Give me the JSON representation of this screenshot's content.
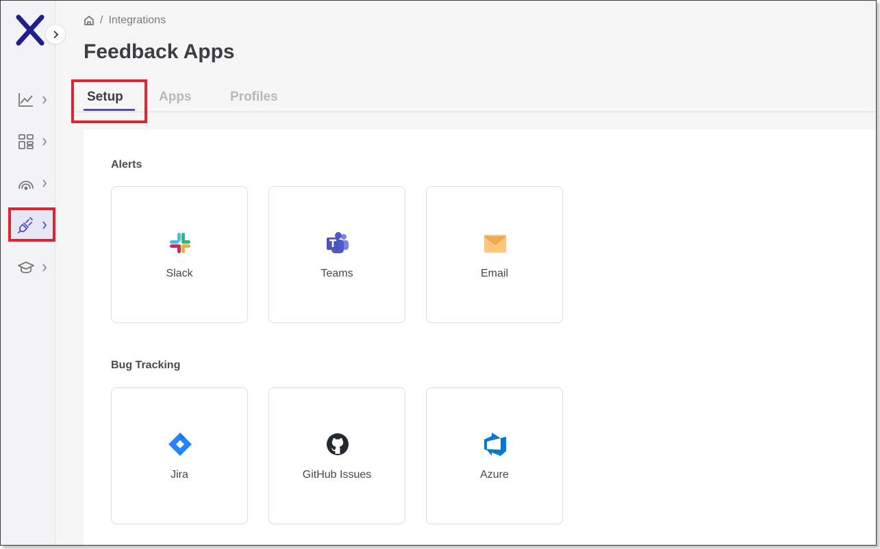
{
  "breadcrumb": {
    "current": "Integrations",
    "separator": "/"
  },
  "page": {
    "title": "Feedback Apps"
  },
  "tabs": [
    {
      "label": "Setup",
      "active": true
    },
    {
      "label": "Apps",
      "active": false
    },
    {
      "label": "Profiles",
      "active": false
    }
  ],
  "sections": {
    "alerts": {
      "title": "Alerts",
      "cards": [
        {
          "label": "Slack",
          "icon": "slack-icon"
        },
        {
          "label": "Teams",
          "icon": "teams-icon"
        },
        {
          "label": "Email",
          "icon": "email-icon"
        }
      ]
    },
    "bug_tracking": {
      "title": "Bug Tracking",
      "cards": [
        {
          "label": "Jira",
          "icon": "jira-icon"
        },
        {
          "label": "GitHub Issues",
          "icon": "github-icon"
        },
        {
          "label": "Azure",
          "icon": "azure-icon"
        }
      ]
    }
  },
  "sidebar": {
    "items": [
      {
        "icon": "chart-line-icon"
      },
      {
        "icon": "dashboard-grid-icon"
      },
      {
        "icon": "signal-gauge-icon"
      },
      {
        "icon": "plug-icon",
        "active": true
      },
      {
        "icon": "graduation-cap-icon"
      }
    ]
  },
  "colors": {
    "accent": "#4a4ac8",
    "highlight": "#e0232e",
    "logo": "#1f1f8f"
  }
}
